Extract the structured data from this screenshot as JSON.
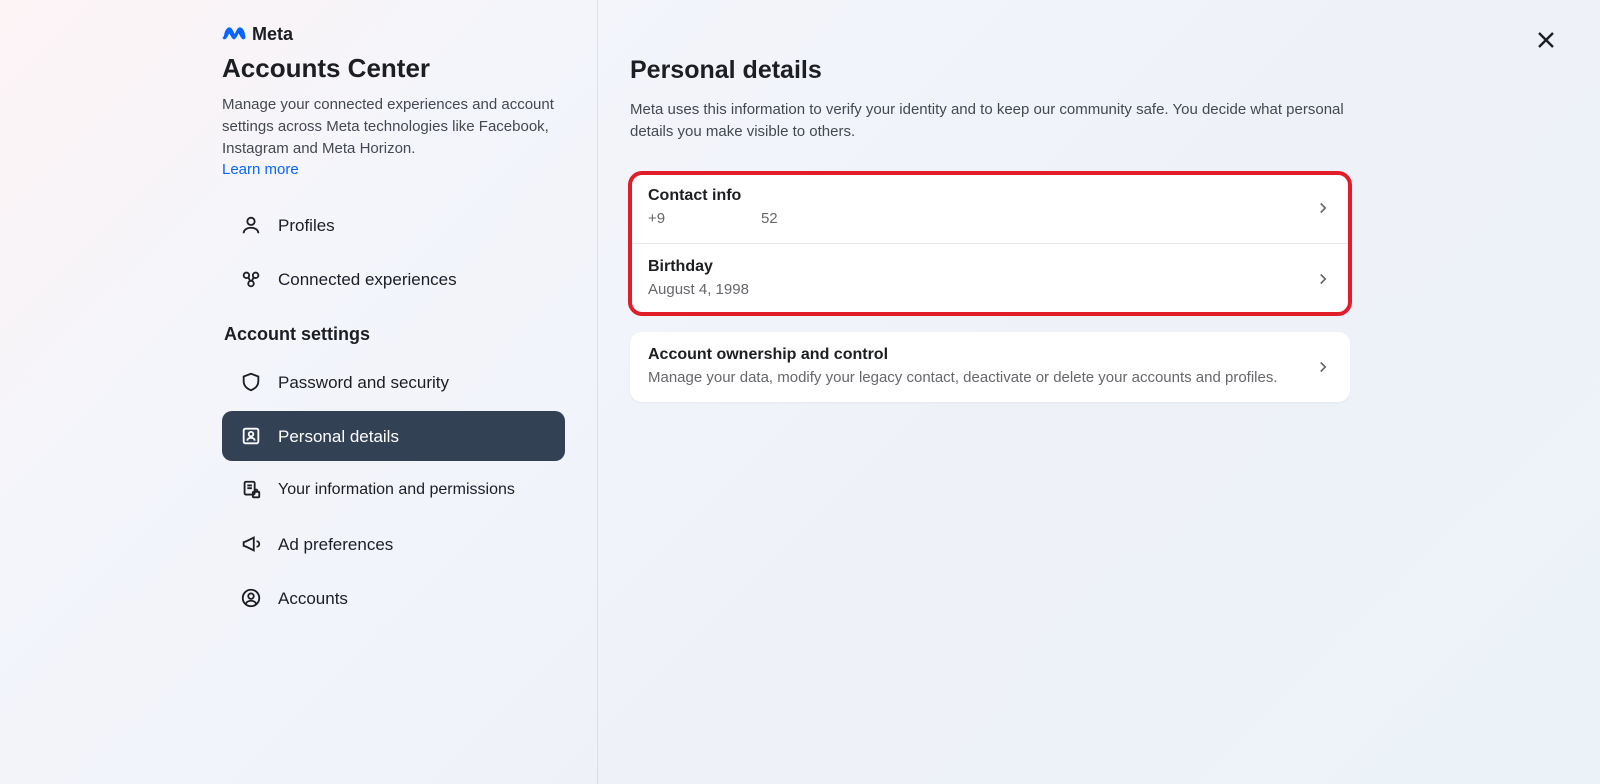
{
  "brand": {
    "name": "Meta"
  },
  "sidebar": {
    "title": "Accounts Center",
    "description": "Manage your connected experiences and account settings across Meta technologies like Facebook, Instagram and Meta Horizon.",
    "learn_more": "Learn more",
    "nav1": [
      {
        "label": "Profiles"
      },
      {
        "label": "Connected experiences"
      }
    ],
    "settings_heading": "Account settings",
    "nav2": [
      {
        "label": "Password and security"
      },
      {
        "label": "Personal details"
      },
      {
        "label": "Your information and permissions"
      },
      {
        "label": "Ad preferences"
      },
      {
        "label": "Accounts"
      }
    ]
  },
  "main": {
    "title": "Personal details",
    "description": "Meta uses this information to verify your identity and to keep our community safe. You decide what personal details you make visible to others.",
    "rows": [
      {
        "title": "Contact info",
        "sub": "+9                       52"
      },
      {
        "title": "Birthday",
        "sub": "August 4, 1998"
      },
      {
        "title": "Account ownership and control",
        "sub": "Manage your data, modify your legacy contact, deactivate or delete your accounts and profiles."
      }
    ]
  }
}
